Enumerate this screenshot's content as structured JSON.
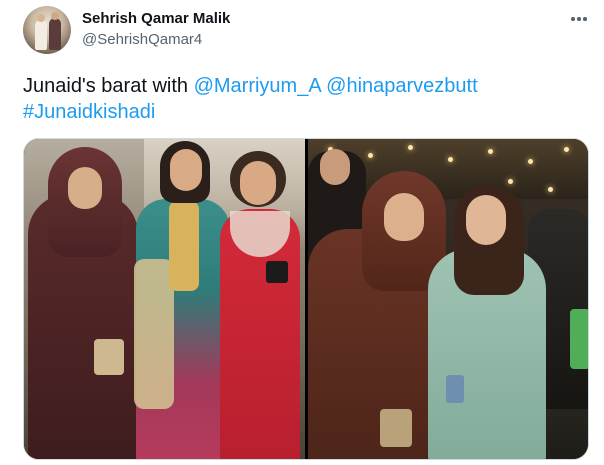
{
  "author": {
    "display_name": "Sehrish Qamar Malik",
    "handle": "@SehrishQamar4",
    "avatar_icon": "profile-photo"
  },
  "menu": {
    "more_icon": "more-horizontal-icon"
  },
  "tweet": {
    "text_prefix": "Junaid's barat with ",
    "mention1": "@Marriyum_A",
    "mention2": "@hinaparvezbutt",
    "hashtag": "#Junaidkishadi"
  },
  "colors": {
    "text": "#0f1419",
    "secondary": "#536471",
    "link": "#1d9bf0",
    "border": "#cfd9de"
  },
  "media": {
    "photo_count": 2,
    "photos": [
      {
        "id": "photo-1"
      },
      {
        "id": "photo-2"
      }
    ]
  }
}
